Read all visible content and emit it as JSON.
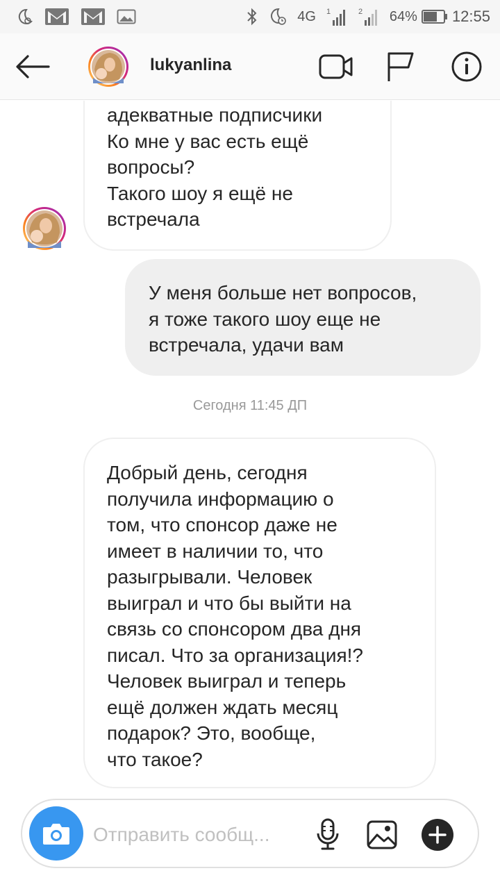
{
  "status_bar": {
    "network": "4G",
    "sim1": "1",
    "sim2": "2",
    "battery": "64%",
    "time": "12:55"
  },
  "header": {
    "username": "lukyanlina",
    "icons": [
      "back-arrow-icon",
      "video-call-icon",
      "flag-icon",
      "info-icon"
    ]
  },
  "messages": [
    {
      "direction": "incoming",
      "text": "адекватные подписчики\nКо мне у вас есть ещё\nвопросы?\nТакого шоу я ещё не\nвстречала"
    },
    {
      "direction": "outgoing",
      "text": "У меня больше нет вопросов,\nя тоже такого шоу еще не\nвстречала, удачи вам"
    }
  ],
  "timestamp": "Сегодня 11:45 ДП",
  "messages_after": [
    {
      "direction": "incoming",
      "text": "Добрый день, сегодня\nполучила информацию о\nтом, что спонсор даже не\nимеет в наличии то, что\nразыгрывали. Человек\nвыиграл и что бы выйти на\nсвязь со спонсором два дня\nписал. Что за организация!?\nЧеловек выиграл и теперь\nещё должен ждать месяц\nподарок? Это, вообще,\nчто такое?"
    }
  ],
  "composer": {
    "placeholder": "Отправить сообщ...",
    "value": ""
  },
  "colors": {
    "accent": "#3897f0",
    "outgoing_bubble": "#efefef",
    "incoming_border": "#efefef",
    "text": "#262626"
  }
}
